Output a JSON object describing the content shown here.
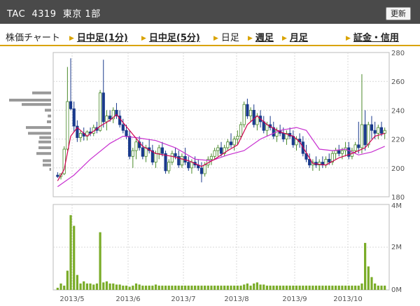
{
  "header": {
    "title": "TAC  4319  東京 1部",
    "refresh_label": "更新"
  },
  "tabs": {
    "label": "株価チャート",
    "items": [
      {
        "label": "日中足(1分)",
        "current": false
      },
      {
        "label": "日中足(5分)",
        "current": false
      },
      {
        "label": "日足",
        "current": true
      },
      {
        "label": "週足",
        "current": false
      },
      {
        "label": "月足",
        "current": false
      },
      {
        "label": "証金・信用",
        "current": false
      }
    ]
  },
  "colors": {
    "up": "#4a8a2a",
    "down": "#1a3a8c",
    "ma_short": "#d00050",
    "ma_long": "#c830d0",
    "volume": "#7aac28",
    "profile": "#999999",
    "grid": "#d8d8d8",
    "accent": "#d9a300"
  },
  "chart_data": [
    {
      "type": "candlestick",
      "ylim": [
        180,
        280
      ],
      "yticks": [
        180,
        200,
        220,
        240,
        260,
        280
      ],
      "xlabels": [
        "2013/5",
        "2013/6",
        "2013/7",
        "2013/8",
        "2013/9",
        "2013/10"
      ],
      "candles": [
        [
          195,
          197,
          193,
          194
        ],
        [
          194,
          196,
          192,
          196
        ],
        [
          196,
          215,
          195,
          213
        ],
        [
          213,
          270,
          212,
          246
        ],
        [
          246,
          276,
          240,
          241
        ],
        [
          241,
          246,
          225,
          229
        ],
        [
          229,
          233,
          218,
          221
        ],
        [
          221,
          226,
          218,
          224
        ],
        [
          224,
          228,
          219,
          222
        ],
        [
          222,
          226,
          219,
          225
        ],
        [
          225,
          228,
          222,
          224
        ],
        [
          224,
          230,
          222,
          228
        ],
        [
          228,
          232,
          224,
          226
        ],
        [
          226,
          254,
          225,
          252
        ],
        [
          252,
          275,
          228,
          232
        ],
        [
          232,
          240,
          226,
          236
        ],
        [
          236,
          240,
          232,
          234
        ],
        [
          234,
          242,
          231,
          240
        ],
        [
          240,
          245,
          234,
          236
        ],
        [
          236,
          240,
          228,
          230
        ],
        [
          230,
          234,
          224,
          226
        ],
        [
          226,
          230,
          220,
          222
        ],
        [
          222,
          226,
          206,
          208
        ],
        [
          208,
          214,
          200,
          212
        ],
        [
          212,
          220,
          206,
          218
        ],
        [
          218,
          222,
          212,
          214
        ],
        [
          214,
          218,
          206,
          208
        ],
        [
          208,
          216,
          204,
          214
        ],
        [
          214,
          220,
          210,
          212
        ],
        [
          212,
          216,
          202,
          204
        ],
        [
          204,
          212,
          200,
          210
        ],
        [
          210,
          216,
          206,
          214
        ],
        [
          214,
          218,
          208,
          210
        ],
        [
          210,
          212,
          196,
          198
        ],
        [
          198,
          206,
          196,
          204
        ],
        [
          204,
          212,
          202,
          210
        ],
        [
          210,
          214,
          206,
          208
        ],
        [
          208,
          212,
          200,
          202
        ],
        [
          202,
          210,
          200,
          208
        ],
        [
          208,
          214,
          202,
          204
        ],
        [
          204,
          208,
          198,
          200
        ],
        [
          200,
          206,
          196,
          204
        ],
        [
          204,
          208,
          200,
          202
        ],
        [
          202,
          206,
          198,
          200
        ],
        [
          200,
          204,
          190,
          196
        ],
        [
          196,
          204,
          194,
          202
        ],
        [
          202,
          208,
          200,
          206
        ],
        [
          206,
          210,
          202,
          208
        ],
        [
          208,
          214,
          206,
          212
        ],
        [
          212,
          216,
          208,
          214
        ],
        [
          214,
          218,
          208,
          210
        ],
        [
          210,
          216,
          208,
          214
        ],
        [
          214,
          220,
          212,
          218
        ],
        [
          218,
          224,
          214,
          216
        ],
        [
          216,
          222,
          212,
          220
        ],
        [
          220,
          226,
          216,
          222
        ],
        [
          222,
          232,
          220,
          230
        ],
        [
          230,
          246,
          228,
          244
        ],
        [
          244,
          248,
          234,
          236
        ],
        [
          236,
          242,
          232,
          240
        ],
        [
          240,
          244,
          228,
          230
        ],
        [
          230,
          238,
          226,
          236
        ],
        [
          236,
          240,
          228,
          232
        ],
        [
          232,
          236,
          224,
          226
        ],
        [
          226,
          232,
          222,
          230
        ],
        [
          230,
          236,
          226,
          228
        ],
        [
          228,
          232,
          220,
          222
        ],
        [
          222,
          228,
          218,
          226
        ],
        [
          226,
          230,
          222,
          224
        ],
        [
          224,
          228,
          218,
          220
        ],
        [
          220,
          226,
          216,
          224
        ],
        [
          224,
          228,
          220,
          222
        ],
        [
          222,
          226,
          214,
          216
        ],
        [
          216,
          222,
          212,
          220
        ],
        [
          220,
          224,
          214,
          218
        ],
        [
          218,
          222,
          208,
          210
        ],
        [
          210,
          216,
          204,
          206
        ],
        [
          206,
          210,
          200,
          202
        ],
        [
          202,
          206,
          198,
          204
        ],
        [
          204,
          208,
          200,
          202
        ],
        [
          202,
          206,
          198,
          204
        ],
        [
          204,
          208,
          200,
          202
        ],
        [
          202,
          208,
          200,
          206
        ],
        [
          206,
          210,
          202,
          204
        ],
        [
          204,
          212,
          202,
          210
        ],
        [
          210,
          214,
          206,
          212
        ],
        [
          212,
          216,
          208,
          210
        ],
        [
          210,
          214,
          206,
          212
        ],
        [
          212,
          218,
          208,
          214
        ],
        [
          214,
          218,
          206,
          208
        ],
        [
          208,
          214,
          206,
          212
        ],
        [
          212,
          218,
          210,
          216
        ],
        [
          216,
          232,
          210,
          214
        ],
        [
          214,
          265,
          210,
          230
        ],
        [
          230,
          240,
          212,
          216
        ],
        [
          216,
          232,
          214,
          230
        ],
        [
          230,
          236,
          220,
          226
        ],
        [
          226,
          232,
          220,
          224
        ],
        [
          224,
          230,
          220,
          228
        ],
        [
          228,
          232,
          222,
          224
        ],
        [
          224,
          228,
          220,
          226
        ]
      ],
      "ma_short": [
        [
          0,
          191
        ],
        [
          2,
          199
        ],
        [
          4,
          222
        ],
        [
          6,
          228
        ],
        [
          9,
          222
        ],
        [
          13,
          229
        ],
        [
          16,
          233
        ],
        [
          18,
          237
        ],
        [
          22,
          226
        ],
        [
          26,
          215
        ],
        [
          30,
          210
        ],
        [
          35,
          208
        ],
        [
          40,
          205
        ],
        [
          44,
          201
        ],
        [
          48,
          206
        ],
        [
          52,
          212
        ],
        [
          55,
          216
        ],
        [
          58,
          230
        ],
        [
          61,
          236
        ],
        [
          64,
          230
        ],
        [
          68,
          225
        ],
        [
          72,
          222
        ],
        [
          74,
          218
        ],
        [
          78,
          203
        ],
        [
          82,
          202
        ],
        [
          86,
          207
        ],
        [
          90,
          210
        ],
        [
          94,
          214
        ],
        [
          97,
          222
        ],
        [
          100,
          224
        ]
      ],
      "ma_long": [
        [
          0,
          187
        ],
        [
          5,
          195
        ],
        [
          10,
          206
        ],
        [
          16,
          217
        ],
        [
          20,
          222
        ],
        [
          24,
          221
        ],
        [
          30,
          219
        ],
        [
          36,
          214
        ],
        [
          42,
          206
        ],
        [
          47,
          205
        ],
        [
          52,
          209
        ],
        [
          57,
          212
        ],
        [
          62,
          220
        ],
        [
          68,
          226
        ],
        [
          73,
          228
        ],
        [
          76,
          226
        ],
        [
          80,
          213
        ],
        [
          84,
          212
        ],
        [
          88,
          213
        ],
        [
          92,
          209
        ],
        [
          96,
          211
        ],
        [
          100,
          215
        ]
      ],
      "price_profile": [
        {
          "price": 252,
          "value": 0.45
        },
        {
          "price": 247,
          "value": 1.0
        },
        {
          "price": 244,
          "value": 0.7
        },
        {
          "price": 240,
          "value": 0.15
        },
        {
          "price": 236,
          "value": 0.08
        },
        {
          "price": 232,
          "value": 0.1
        },
        {
          "price": 228,
          "value": 0.6
        },
        {
          "price": 224,
          "value": 0.55
        },
        {
          "price": 221,
          "value": 0.28
        },
        {
          "price": 218,
          "value": 0.3
        },
        {
          "price": 214,
          "value": 0.3
        },
        {
          "price": 210,
          "value": 0.35
        },
        {
          "price": 205,
          "value": 0.2
        },
        {
          "price": 202,
          "value": 0.2
        },
        {
          "price": 199,
          "value": 0.04
        }
      ]
    },
    {
      "type": "bar",
      "ylim": [
        0,
        4
      ],
      "yticks": [
        "0M",
        "2M",
        "4M"
      ],
      "values": [
        0.1,
        0.3,
        0.2,
        0.9,
        3.5,
        3.0,
        0.7,
        0.3,
        0.4,
        0.3,
        0.3,
        0.25,
        0.3,
        2.7,
        0.35,
        0.4,
        0.3,
        0.3,
        0.25,
        0.25,
        0.2,
        0.2,
        0.15,
        0.2,
        0.3,
        0.25,
        0.2,
        0.2,
        0.2,
        0.2,
        0.25,
        0.2,
        0.2,
        0.2,
        0.2,
        0.2,
        0.2,
        0.2,
        0.2,
        0.2,
        0.2,
        0.2,
        0.2,
        0.2,
        0.2,
        0.2,
        0.2,
        0.2,
        0.2,
        0.2,
        0.2,
        0.2,
        0.2,
        0.2,
        0.2,
        0.2,
        0.2,
        0.25,
        0.3,
        0.2,
        0.3,
        0.35,
        0.25,
        0.25,
        0.2,
        0.2,
        0.2,
        0.2,
        0.2,
        0.2,
        0.2,
        0.2,
        0.2,
        0.2,
        0.2,
        0.2,
        0.2,
        0.2,
        0.2,
        0.2,
        0.2,
        0.2,
        0.2,
        0.2,
        0.2,
        0.2,
        0.2,
        0.2,
        0.2,
        0.2,
        0.2,
        0.2,
        0.2,
        0.3,
        2.2,
        1.1,
        0.6,
        0.3,
        0.2,
        0.2,
        0.2
      ]
    }
  ]
}
